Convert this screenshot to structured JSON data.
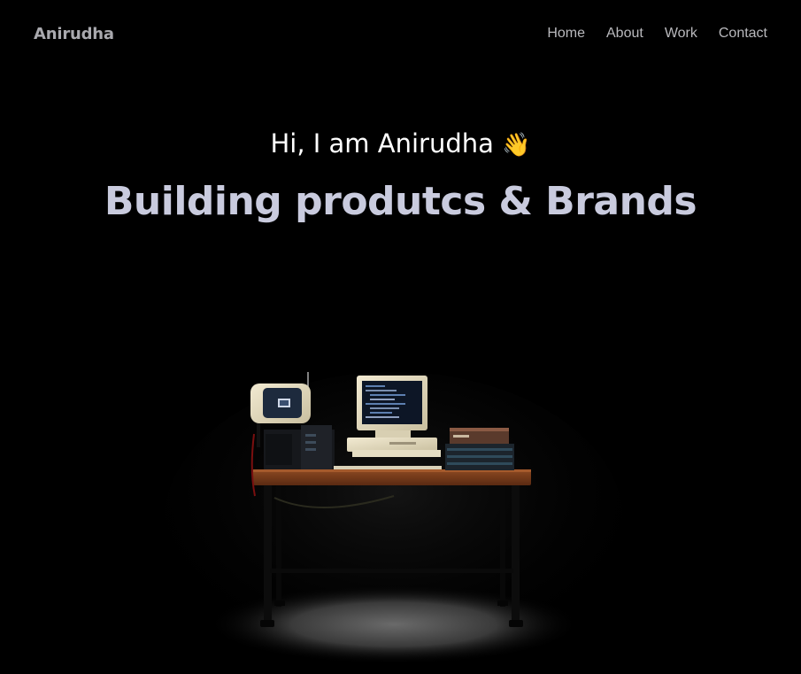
{
  "nav": {
    "brand": "Anirudha",
    "links": [
      "Home",
      "About",
      "Work",
      "Contact"
    ]
  },
  "hero": {
    "greeting": "Hi, I am Anirudha",
    "greeting_emoji": "👋",
    "headline": "Building produtcs & Brands"
  },
  "scene": {
    "description_icon": "desk-setup-illustration"
  },
  "colors": {
    "background": "#000000",
    "brand": "#a9a9ae",
    "nav_link": "#b9b9bd",
    "headline": "#c9cbde",
    "desk_wood": "#7a3a1a"
  }
}
